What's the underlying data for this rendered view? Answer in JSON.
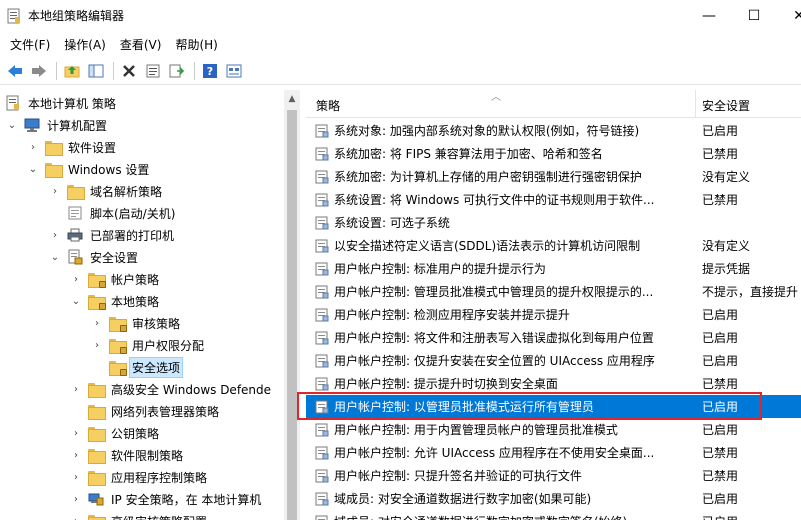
{
  "window": {
    "title": "本地组策略编辑器",
    "controls": {
      "minimize": "—",
      "maximize": "☐",
      "close": "✕"
    }
  },
  "menu": [
    "文件(F)",
    "操作(A)",
    "查看(V)",
    "帮助(H)"
  ],
  "tree": {
    "items": [
      {
        "label": "本地计算机 策略",
        "depth": 0,
        "expander": "",
        "icon": "policy-icon"
      },
      {
        "label": "计算机配置",
        "depth": 1,
        "expander": "⌄",
        "icon": "computer-icon"
      },
      {
        "label": "软件设置",
        "depth": 2,
        "expander": "›",
        "icon": "folder-icon"
      },
      {
        "label": "Windows 设置",
        "depth": 2,
        "expander": "⌄",
        "icon": "folder-icon"
      },
      {
        "label": "域名解析策略",
        "depth": 3,
        "expander": "›",
        "icon": "folder-icon"
      },
      {
        "label": "脚本(启动/关机)",
        "depth": 3,
        "expander": "",
        "icon": "script-icon"
      },
      {
        "label": "已部署的打印机",
        "depth": 3,
        "expander": "›",
        "icon": "printer-icon"
      },
      {
        "label": "安全设置",
        "depth": 3,
        "expander": "⌄",
        "icon": "security-icon"
      },
      {
        "label": "帐户策略",
        "depth": 4,
        "expander": "›",
        "icon": "lock-folder-icon"
      },
      {
        "label": "本地策略",
        "depth": 4,
        "expander": "⌄",
        "icon": "lock-folder-icon"
      },
      {
        "label": "审核策略",
        "depth": 5,
        "expander": "›",
        "icon": "lock-folder-icon"
      },
      {
        "label": "用户权限分配",
        "depth": 5,
        "expander": "›",
        "icon": "lock-folder-icon"
      },
      {
        "label": "安全选项",
        "depth": 5,
        "expander": "",
        "icon": "lock-folder-icon",
        "selected": true
      },
      {
        "label": "高级安全 Windows Defende",
        "depth": 4,
        "expander": "›",
        "icon": "folder-icon"
      },
      {
        "label": "网络列表管理器策略",
        "depth": 4,
        "expander": "",
        "icon": "folder-icon"
      },
      {
        "label": "公钥策略",
        "depth": 4,
        "expander": "›",
        "icon": "folder-icon"
      },
      {
        "label": "软件限制策略",
        "depth": 4,
        "expander": "›",
        "icon": "folder-icon"
      },
      {
        "label": "应用程序控制策略",
        "depth": 4,
        "expander": "›",
        "icon": "folder-icon"
      },
      {
        "label": "IP 安全策略，在 本地计算机",
        "depth": 4,
        "expander": "›",
        "icon": "ipsec-icon"
      },
      {
        "label": "高级审核策略配置",
        "depth": 4,
        "expander": "›",
        "icon": "folder-icon"
      }
    ]
  },
  "list": {
    "columns": {
      "policy": "策略",
      "setting": "安全设置"
    },
    "rows": [
      {
        "name": "系统对象: 加强内部系统对象的默认权限(例如，符号链接)",
        "setting": "已启用"
      },
      {
        "name": "系统加密: 将 FIPS 兼容算法用于加密、哈希和签名",
        "setting": "已禁用"
      },
      {
        "name": "系统加密: 为计算机上存储的用户密钥强制进行强密钥保护",
        "setting": "没有定义"
      },
      {
        "name": "系统设置: 将 Windows 可执行文件中的证书规则用于软件...",
        "setting": "已禁用"
      },
      {
        "name": "系统设置: 可选子系统",
        "setting": ""
      },
      {
        "name": "以安全描述符定义语言(SDDL)语法表示的计算机访问限制",
        "setting": "没有定义"
      },
      {
        "name": "用户帐户控制: 标准用户的提升提示行为",
        "setting": "提示凭据"
      },
      {
        "name": "用户帐户控制: 管理员批准模式中管理员的提升权限提示的...",
        "setting": "不提示，直接提升"
      },
      {
        "name": "用户帐户控制: 检测应用程序安装并提示提升",
        "setting": "已启用"
      },
      {
        "name": "用户帐户控制: 将文件和注册表写入错误虚拟化到每用户位置",
        "setting": "已启用"
      },
      {
        "name": "用户帐户控制: 仅提升安装在安全位置的 UIAccess 应用程序",
        "setting": "已启用"
      },
      {
        "name": "用户帐户控制: 提示提升时切换到安全桌面",
        "setting": "已禁用"
      },
      {
        "name": "用户帐户控制: 以管理员批准模式运行所有管理员",
        "setting": "已启用",
        "selected": true
      },
      {
        "name": "用户帐户控制: 用于内置管理员帐户的管理员批准模式",
        "setting": "已启用"
      },
      {
        "name": "用户帐户控制: 允许 UIAccess 应用程序在不使用安全桌面...",
        "setting": "已禁用"
      },
      {
        "name": "用户帐户控制: 只提升签名并验证的可执行文件",
        "setting": "已禁用"
      },
      {
        "name": "域成员: 对安全通道数据进行数字加密(如果可能)",
        "setting": "已启用"
      },
      {
        "name": "域成员: 对安全通道数据进行数字加密或数字签名(始终)",
        "setting": "已启用"
      }
    ]
  }
}
